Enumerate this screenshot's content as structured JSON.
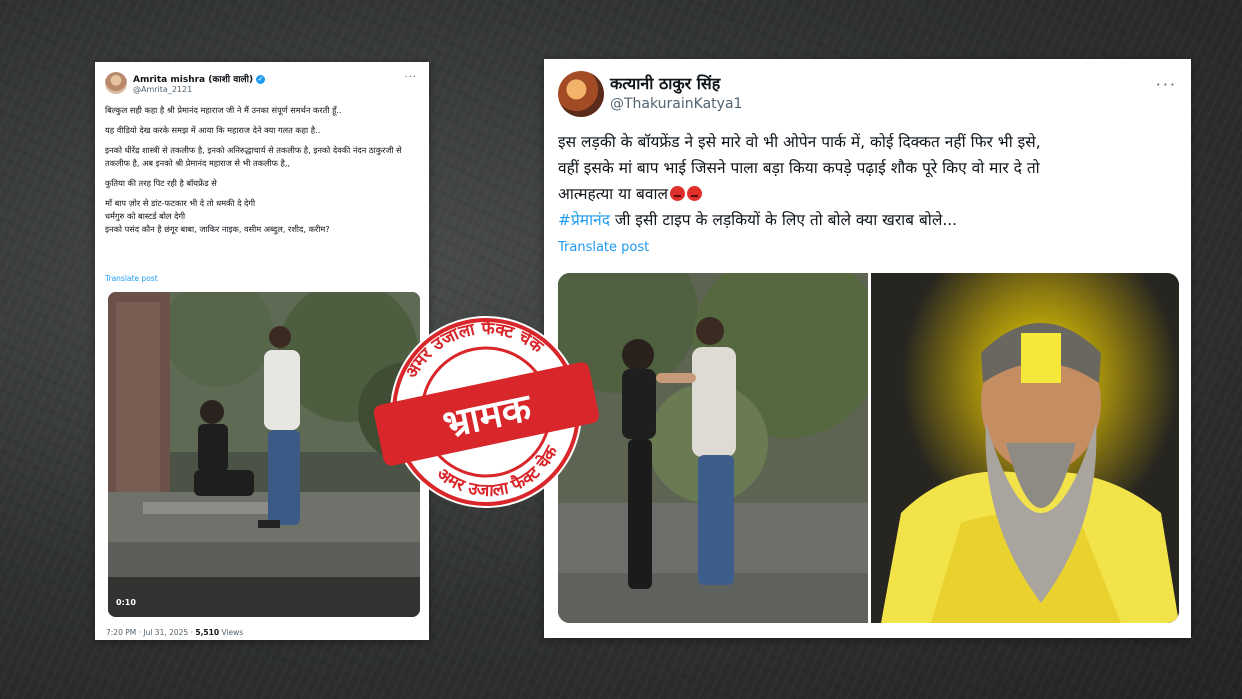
{
  "left_tweet": {
    "author_name": "Amrita mishra (काशी वाली)",
    "verified_badge": "✓",
    "handle": "@Amrita_2121",
    "more_label": "···",
    "paragraphs": [
      "बिल्कुल सही कहा है श्री प्रेमानंद महाराज जी ने मैं उनका संपूर्ण समर्थन करती हूँ..",
      "यह वीडियो देख करके समझ में आया कि महाराज देने क्या गलत कहा है..",
      "इनको धीरेंद्र शास्त्री से तकलीफ है, इनको अनिरुद्धाचार्य से तकलीफ है, इनको देवकी नंदन ठाकुरजी से तकलीफ है, अब इनको श्री प्रेमानंद महाराज से भी तकलीफ है,,",
      "कुतिया की तरह पिट रही है बॉयफ्रेंड से",
      "माँ बाप ज़ोर से डांट-फटकार भी दे तो धमकी दे देगी\nधर्मगुरु को बास्टर्ड बोल देगी\nइनको पसंद कौन है छंगूर बाबा, जाकिर नाइक, वसीम अब्दुल, रशीद, करीम?"
    ],
    "translate_label": "Translate post",
    "video_time": "0:10",
    "timestamp": "7:20 PM · Jul 31, 2025 · ",
    "views_count": "5,510",
    "views_label": " Views"
  },
  "right_tweet": {
    "author_name": "कत्यानी ठाकुर सिंह",
    "handle": "@ThakurainKatya1",
    "more_label": "···",
    "body_line_1": "इस लड़की के बॉयफ्रेंड ने इसे मारे वो भी ओपेन पार्क में, कोई दिक्कत नहीं फिर भी इसे,",
    "body_line_2": "वहीं इसके मां बाप भाई जिसने पाला बड़ा किया कपड़े पढ़ाई शौक पूरे किए वो मार दे तो",
    "body_line_3": "आत्महत्या या बवाल",
    "hashtag": "#प्रेमानंद",
    "body_line_4": " जी इसी टाइप के लड़कियों के लिए तो बोले क्या खराब बोले...",
    "translate_label": "Translate post"
  },
  "stamp": {
    "top_arc_text": "अमर उजाला फैक्ट चेक",
    "bottom_arc_text": "अमर उजाला फैक्ट चेक",
    "verdict": "भ्रामक",
    "color": "#d8262a"
  },
  "colors": {
    "link_blue": "#1d9bf0",
    "stamp_red": "#d8262a",
    "saffron": "#f0d000"
  }
}
